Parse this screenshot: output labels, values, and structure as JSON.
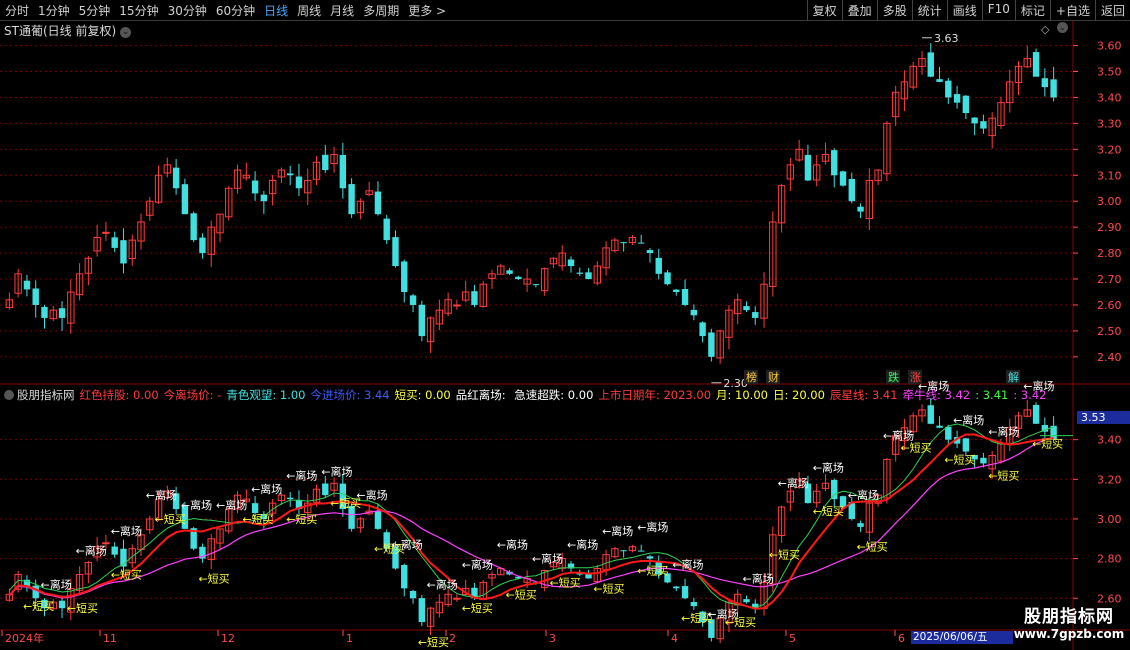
{
  "toolbar": {
    "periods": [
      "分时",
      "1分钟",
      "5分钟",
      "15分钟",
      "30分钟",
      "60分钟",
      "日线",
      "周线",
      "月线",
      "多周期",
      "更多 >"
    ],
    "active_period": "日线",
    "buttons": [
      "复权",
      "叠加",
      "多股",
      "统计",
      "画线",
      "F10",
      "标记",
      "+自选",
      "返回"
    ]
  },
  "price_panel": {
    "title": "ST通葡(日线 前复权)",
    "high_label": "3.63",
    "low_label": "2.30",
    "y_ticks": [
      "3.60",
      "3.50",
      "3.40",
      "3.30",
      "3.20",
      "3.10",
      "3.00",
      "2.90",
      "2.80",
      "2.70",
      "2.60",
      "2.50",
      "2.40"
    ],
    "markers": [
      "榜",
      "财",
      "跌",
      "涨",
      "解"
    ]
  },
  "indicator_panel": {
    "name": "股朋指标网",
    "fields": [
      {
        "label": "红色持股:",
        "value": "0.00",
        "color": "#ff3b3b"
      },
      {
        "label": "今离场价:",
        "value": "-",
        "color": "#ff3b3b"
      },
      {
        "label": "青色观望:",
        "value": "1.00",
        "color": "#40e0e0"
      },
      {
        "label": "今进场价:",
        "value": "3.44",
        "color": "#3a5bff"
      },
      {
        "label": "短买:",
        "value": "0.00",
        "color": "#ffff40"
      },
      {
        "label": "品红离场:",
        "value": "",
        "color": "#ffffff"
      },
      {
        "label": "急速超跌:",
        "value": "0.00",
        "color": "#ffffff"
      },
      {
        "label": "上市日期年:",
        "value": "2023.00",
        "color": "#ff3b3b"
      },
      {
        "label": "月:",
        "value": "10.00",
        "color": "#ffff40"
      },
      {
        "label": "日:",
        "value": "20.00",
        "color": "#ffff40"
      },
      {
        "label": "辰星线:",
        "value": "3.41",
        "color": "#ff3b3b"
      },
      {
        "label": "牵牛线:",
        "value": "3.42",
        "color": "#ff40ff"
      },
      {
        "label": ":",
        "value": "3.41",
        "color": "#40ff40"
      },
      {
        "label": ":",
        "value": "3.42",
        "color": "#ff40ff"
      }
    ],
    "price_box": "3.53",
    "y_ticks": [
      "3.40",
      "3.20",
      "3.00",
      "2.80",
      "2.60"
    ],
    "sell_label": "←离场",
    "buy_label": "←短买"
  },
  "x_axis": {
    "labels": [
      "2024年",
      "11",
      "12",
      "1",
      "2",
      "3",
      "4",
      "5",
      "6"
    ],
    "current_date": "2025/06/06/五"
  },
  "watermark": {
    "title": "股朋指标网",
    "url": "www.7gpzb.com"
  },
  "colors": {
    "up": "#ff3b3b",
    "down": "#40e0e0",
    "grid": "#7a0000",
    "axis_text": "#ff4b4b",
    "buy": "#ffff40",
    "sell": "#ffffff",
    "line_red": "#ff1818",
    "line_magenta": "#ff40ff",
    "line_green": "#30d050"
  },
  "chart_data": {
    "type": "candlestick",
    "title": "ST通葡(日线 前复权)",
    "ylim": [
      2.3,
      3.63
    ],
    "high": 3.63,
    "low": 2.3,
    "x_labels": [
      "2024年",
      "11",
      "12",
      "1",
      "2",
      "3",
      "4",
      "5",
      "6"
    ],
    "close": [
      2.62,
      2.72,
      2.66,
      2.6,
      2.55,
      2.58,
      2.55,
      2.65,
      2.72,
      2.78,
      2.86,
      2.88,
      2.82,
      2.76,
      2.85,
      2.92,
      3.0,
      3.1,
      3.14,
      3.05,
      2.95,
      2.85,
      2.8,
      2.9,
      2.95,
      3.05,
      3.12,
      3.1,
      3.03,
      3.0,
      3.08,
      3.12,
      3.1,
      3.05,
      3.08,
      3.15,
      3.12,
      3.18,
      3.05,
      2.95,
      3.0,
      3.04,
      2.95,
      2.85,
      2.75,
      2.65,
      2.6,
      2.48,
      2.55,
      2.58,
      2.62,
      2.6,
      2.65,
      2.6,
      2.68,
      2.72,
      2.75,
      2.72,
      2.7,
      2.7,
      2.68,
      2.74,
      2.78,
      2.8,
      2.75,
      2.72,
      2.7,
      2.75,
      2.82,
      2.85,
      2.84,
      2.86,
      2.84,
      2.8,
      2.72,
      2.68,
      2.65,
      2.6,
      2.56,
      2.48,
      2.4,
      2.5,
      2.58,
      2.62,
      2.58,
      2.55,
      2.68,
      2.92,
      3.06,
      3.14,
      3.2,
      3.08,
      3.14,
      3.18,
      3.1,
      3.06,
      3.0,
      2.96,
      3.08,
      3.12,
      3.3,
      3.42,
      3.46,
      3.52,
      3.55,
      3.48,
      3.46,
      3.4,
      3.38,
      3.34,
      3.3,
      3.28,
      3.32,
      3.38,
      3.46,
      3.52,
      3.55,
      3.48,
      3.44,
      3.4
    ]
  }
}
